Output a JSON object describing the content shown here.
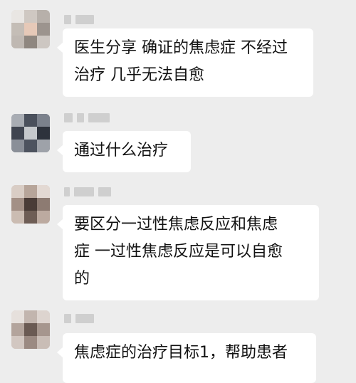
{
  "chat": {
    "messages": [
      {
        "text": "医生分享 确证的焦虑症 不经过\n治疗 几乎无法自愈"
      },
      {
        "text": "通过什么治疗"
      },
      {
        "text": "要区分一过性焦虑反应和焦虑\n症 一过性焦虑反应是可以自愈\n的"
      },
      {
        "text": "焦虑症的治疗目标1，帮助患者"
      }
    ]
  },
  "colors": {
    "background": "#ededed",
    "bubble": "#ffffff",
    "text": "#111111"
  }
}
